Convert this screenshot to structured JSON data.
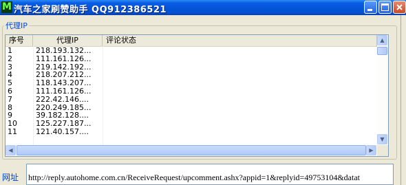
{
  "window": {
    "title": "汽车之家刷赞助手  QQ912386521",
    "icon_letter": "M"
  },
  "group": {
    "label": "代理IP"
  },
  "table": {
    "columns": [
      "序号",
      "代理IP",
      "评论状态"
    ],
    "rows": [
      {
        "num": "1",
        "ip": "218.193.132..."
      },
      {
        "num": "2",
        "ip": "111.161.126..."
      },
      {
        "num": "3",
        "ip": "219.142.192..."
      },
      {
        "num": "4",
        "ip": "218.207.212..."
      },
      {
        "num": "5",
        "ip": "118.143.207..."
      },
      {
        "num": "6",
        "ip": "111.161.126..."
      },
      {
        "num": "7",
        "ip": "222.42.146...."
      },
      {
        "num": "8",
        "ip": "220.249.185..."
      },
      {
        "num": "9",
        "ip": "39.182.128...."
      },
      {
        "num": "10",
        "ip": "125.227.187..."
      },
      {
        "num": "11",
        "ip": "121.40.157...."
      }
    ]
  },
  "url": {
    "label": "网址",
    "value": "http://reply.autohome.com.cn/ReceiveRequest/upcomment.ashx?appid=1&replyid=49753104&datat"
  }
}
